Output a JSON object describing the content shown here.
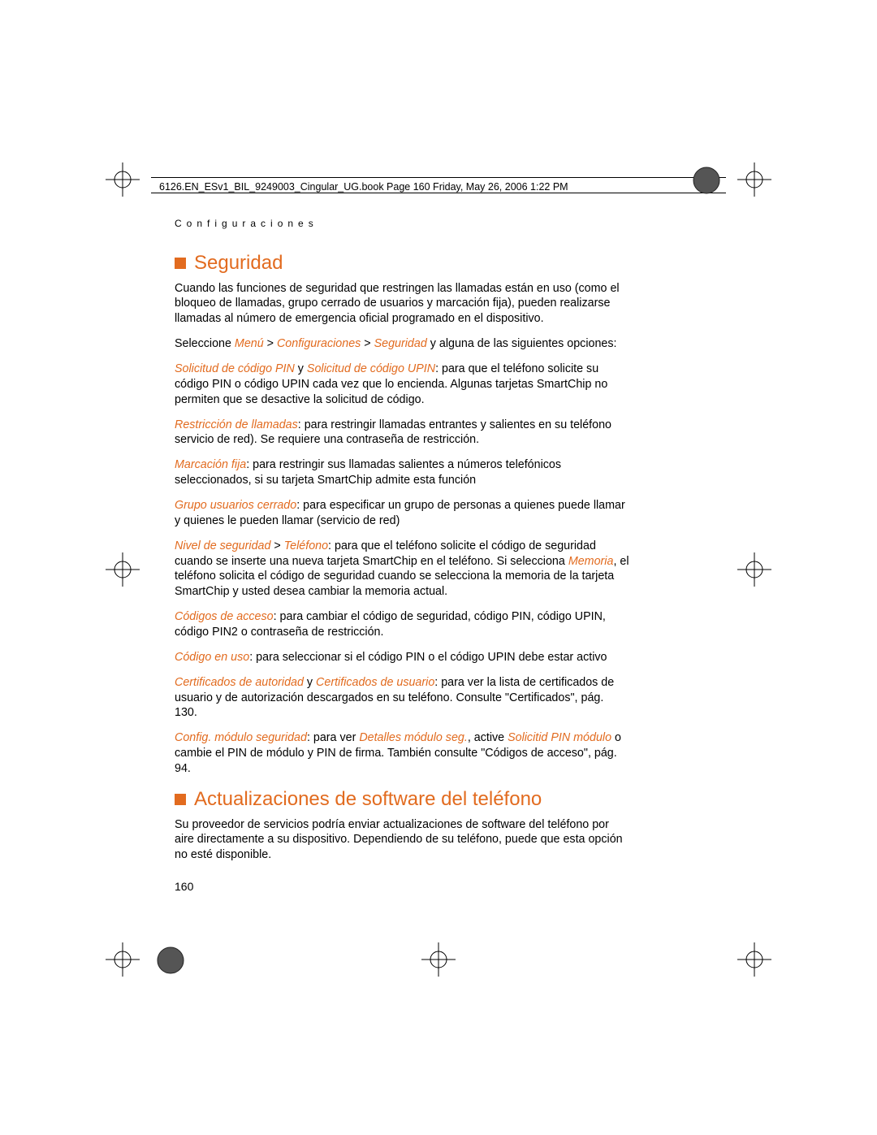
{
  "header": "6126.EN_ESv1_BIL_9249003_Cingular_UG.book  Page 160  Friday, May 26, 2006  1:22 PM",
  "section_label": "Configuraciones",
  "h1_seguridad": "Seguridad",
  "p_intro": "Cuando las funciones de seguridad que restringen las llamadas están en uso (como el bloqueo de llamadas, grupo cerrado de usuarios y marcación fija), pueden realizarse llamadas al número de emergencia oficial programado en el dispositivo.",
  "p_select_pre": "Seleccione ",
  "menu": "Menú",
  "gt1": " > ",
  "conf": "Configuraciones",
  "gt2": " > ",
  "seg": "Seguridad",
  "p_select_post": " y alguna de las siguientes opciones:",
  "pin_req": "Solicitud de código PIN",
  "pin_y": " y ",
  "upin_req": "Solicitud de código UPIN",
  "p_pin_post": ": para que el teléfono solicite su código PIN o código UPIN cada vez que lo encienda. Algunas tarjetas SmartChip no permiten que se desactive la solicitud de código.",
  "rest": "Restricción de llamadas",
  "p_rest_post": ": para restringir llamadas entrantes y salientes en su teléfono servicio de red). Se requiere una contraseña de restricción.",
  "marc": "Marcación fija",
  "p_marc_post": ": para restringir sus llamadas salientes a números telefónicos seleccionados, si su tarjeta SmartChip admite esta función",
  "grupo": "Grupo usuarios cerrado",
  "p_grupo_post": ": para especificar un grupo de personas a quienes puede llamar y quienes le pueden llamar (servicio de red)",
  "nivel": "Nivel de seguridad",
  "gt3": " > ",
  "tel": "Teléfono",
  "p_nivel_mid": ": para que el teléfono solicite el código de seguridad cuando se inserte una nueva tarjeta SmartChip en el teléfono. Si selecciona ",
  "memoria": "Memoria",
  "p_nivel_post": ", el teléfono solicita el código de seguridad cuando se selecciona la memoria de la tarjeta SmartChip y usted desea cambiar la memoria actual.",
  "codigos": "Códigos de acceso",
  "p_codigos_post": ": para cambiar el código de seguridad, código PIN, código UPIN, código PIN2 o contraseña de restricción.",
  "codigo_uso": "Código en uso",
  "p_codigo_uso_post": ": para seleccionar si el código PIN o el código UPIN debe estar activo",
  "cert_auth": "Certificados de autoridad",
  "cert_y": " y ",
  "cert_user": "Certificados de usuario",
  "p_cert_post": ": para ver la lista de certificados de usuario y de autorización descargados en su teléfono. Consulte \"Certificados\", pág. 130.",
  "conf_mod": "Config. módulo seguridad",
  "p_conf_mid1": ": para ver ",
  "det_mod": "Detalles módulo seg.",
  "p_conf_mid2": ", active ",
  "sol_pin": "Solicitid PIN módulo",
  "p_conf_post": " o cambie el PIN de módulo y PIN de firma. También consulte \"Códigos de acceso\", pág. 94.",
  "h1_actual": "Actualizaciones de software del teléfono",
  "p_actual": "Su proveedor de servicios podría enviar actualizaciones de software del teléfono por aire directamente a su dispositivo. Dependiendo de su teléfono, puede que esta opción no esté disponible.",
  "pagenum": "160"
}
